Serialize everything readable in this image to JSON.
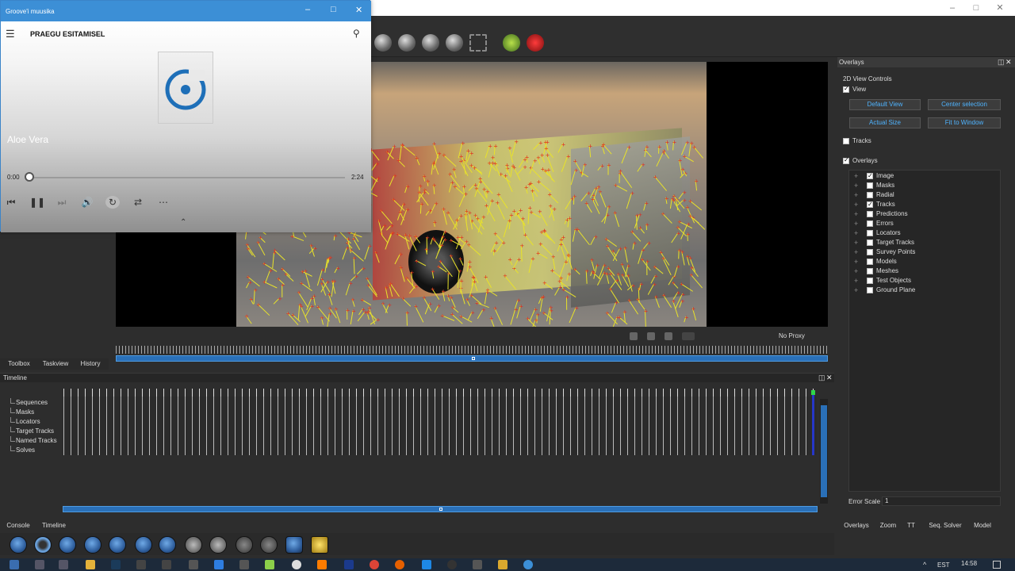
{
  "groove": {
    "title": "Groove'i muusika",
    "header": "PRAEGU ESITAMISEL",
    "track": "Aloe Vera",
    "time_elapsed": "0:00",
    "time_total": "2:24",
    "progress": 0.0,
    "icons": [
      "hamburger-icon",
      "search-icon",
      "previous-icon",
      "pause-icon",
      "next-icon",
      "volume-icon",
      "repeat-icon",
      "shuffle-icon",
      "more-icon",
      "chevron-up-icon"
    ]
  },
  "main": {
    "left_tabs": [
      "Toolbox",
      "Taskview",
      "History"
    ],
    "proxy_label": "No Proxy",
    "timeline_title": "Timeline",
    "timeline_tree": [
      "Sequences",
      "Masks",
      "Locators",
      "Target Tracks",
      "Named Tracks",
      "Solves"
    ],
    "bottom_tabs": [
      "Console",
      "Timeline"
    ]
  },
  "overlays": {
    "title": "Overlays",
    "section_2d": "2D View Controls",
    "view_label": "View",
    "buttons": [
      "Default View",
      "Center selection",
      "Actual Size",
      "Fit to Window"
    ],
    "tracks_label": "Tracks",
    "overlays_label": "Overlays",
    "items": [
      {
        "label": "Image",
        "checked": true
      },
      {
        "label": "Masks",
        "checked": false
      },
      {
        "label": "Radial",
        "checked": false
      },
      {
        "label": "Tracks",
        "checked": true
      },
      {
        "label": "Predictions",
        "checked": false
      },
      {
        "label": "Errors",
        "checked": false
      },
      {
        "label": "Locators",
        "checked": false
      },
      {
        "label": "Target Tracks",
        "checked": false
      },
      {
        "label": "Survey Points",
        "checked": false
      },
      {
        "label": "Models",
        "checked": false
      },
      {
        "label": "Meshes",
        "checked": false
      },
      {
        "label": "Test Objects",
        "checked": false
      },
      {
        "label": "Ground Plane",
        "checked": false
      }
    ],
    "error_scale_label": "Error Scale",
    "error_scale_value": "1",
    "tabs": [
      "Overlays",
      "Zoom",
      "TT",
      "Seq. Solver",
      "Model"
    ]
  },
  "taskbar": {
    "language": "EST",
    "time": "14:58"
  },
  "colors": {
    "accent": "#3c8fd6",
    "track_yellow": "#e8e22a",
    "track_red": "#e0281e",
    "scrub_blue": "#2a70b8"
  }
}
